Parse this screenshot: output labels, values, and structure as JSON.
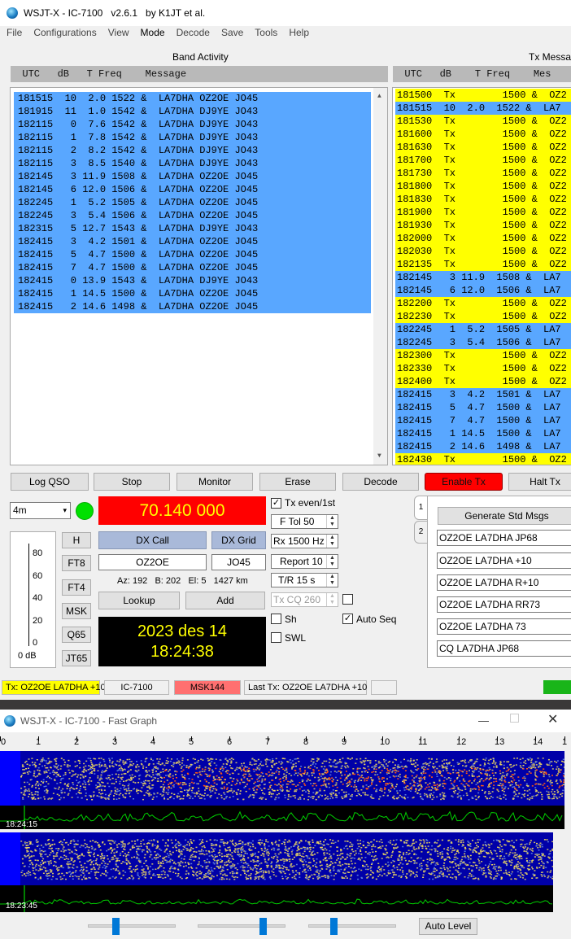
{
  "main_window": {
    "title": "WSJT-X - IC-7100   v2.6.1   by K1JT et al.",
    "menu": [
      "File",
      "Configurations",
      "View",
      "Mode",
      "Decode",
      "Save",
      "Tools",
      "Help"
    ],
    "band_activity_label": "Band Activity",
    "tx_messages_label": "Tx Messag",
    "columns_header": "  UTC   dB   T Freq    Message",
    "rx_columns_header": "  UTC   dB    T Freq    Mes",
    "band_activity_rows": [
      "181515  10  2.0 1522 &  LA7DHA OZ2OE JO45",
      "181915  11  1.0 1542 &  LA7DHA DJ9YE JO43",
      "182115   0  7.6 1542 &  LA7DHA DJ9YE JO43",
      "182115   1  7.8 1542 &  LA7DHA DJ9YE JO43",
      "182115   2  8.2 1542 &  LA7DHA DJ9YE JO43",
      "182115   3  8.5 1540 &  LA7DHA DJ9YE JO43",
      "182145   3 11.9 1508 &  LA7DHA OZ2OE JO45",
      "182145   6 12.0 1506 &  LA7DHA OZ2OE JO45",
      "182245   1  5.2 1505 &  LA7DHA OZ2OE JO45",
      "182245   3  5.4 1506 &  LA7DHA OZ2OE JO45",
      "182315   5 12.7 1543 &  LA7DHA DJ9YE JO43",
      "182415   3  4.2 1501 &  LA7DHA OZ2OE JO45",
      "182415   5  4.7 1500 &  LA7DHA OZ2OE JO45",
      "182415   7  4.7 1500 &  LA7DHA OZ2OE JO45",
      "182415   0 13.9 1543 &  LA7DHA DJ9YE JO43",
      "182415   1 14.5 1500 &  LA7DHA OZ2OE JO45",
      "182415   2 14.6 1498 &  LA7DHA OZ2OE JO45"
    ],
    "rx_rows": [
      {
        "text": "181500  Tx        1500 &  OZ2",
        "color": "yellow"
      },
      {
        "text": "181515  10  2.0  1522 &  LA7",
        "color": "blue"
      },
      {
        "text": "181530  Tx        1500 &  OZ2",
        "color": "yellow"
      },
      {
        "text": "181600  Tx        1500 &  OZ2",
        "color": "yellow"
      },
      {
        "text": "181630  Tx        1500 &  OZ2",
        "color": "yellow"
      },
      {
        "text": "181700  Tx        1500 &  OZ2",
        "color": "yellow"
      },
      {
        "text": "181730  Tx        1500 &  OZ2",
        "color": "yellow"
      },
      {
        "text": "181800  Tx        1500 &  OZ2",
        "color": "yellow"
      },
      {
        "text": "181830  Tx        1500 &  OZ2",
        "color": "yellow"
      },
      {
        "text": "181900  Tx        1500 &  OZ2",
        "color": "yellow"
      },
      {
        "text": "181930  Tx        1500 &  OZ2",
        "color": "yellow"
      },
      {
        "text": "182000  Tx        1500 &  OZ2",
        "color": "yellow"
      },
      {
        "text": "182030  Tx        1500 &  OZ2",
        "color": "yellow"
      },
      {
        "text": "182135  Tx        1500 &  OZ2",
        "color": "yellow"
      },
      {
        "text": "182145   3 11.9  1508 &  LA7",
        "color": "blue"
      },
      {
        "text": "182145   6 12.0  1506 &  LA7",
        "color": "blue"
      },
      {
        "text": "182200  Tx        1500 &  OZ2",
        "color": "yellow"
      },
      {
        "text": "182230  Tx        1500 &  OZ2",
        "color": "yellow"
      },
      {
        "text": "182245   1  5.2  1505 &  LA7",
        "color": "blue"
      },
      {
        "text": "182245   3  5.4  1506 &  LA7",
        "color": "blue"
      },
      {
        "text": "182300  Tx        1500 &  OZ2",
        "color": "yellow"
      },
      {
        "text": "182330  Tx        1500 &  OZ2",
        "color": "yellow"
      },
      {
        "text": "182400  Tx        1500 &  OZ2",
        "color": "yellow"
      },
      {
        "text": "182415   3  4.2  1501 &  LA7",
        "color": "blue"
      },
      {
        "text": "182415   5  4.7  1500 &  LA7",
        "color": "blue"
      },
      {
        "text": "182415   7  4.7  1500 &  LA7",
        "color": "blue"
      },
      {
        "text": "182415   1 14.5  1500 &  LA7",
        "color": "blue"
      },
      {
        "text": "182415   2 14.6  1498 &  LA7",
        "color": "blue"
      },
      {
        "text": "182430  Tx        1500 &  OZ2",
        "color": "yellow"
      }
    ],
    "buttons": {
      "log_qso": "Log QSO",
      "stop": "Stop",
      "monitor": "Monitor",
      "erase": "Erase",
      "decode": "Decode",
      "enable_tx": "Enable Tx",
      "halt_tx": "Halt Tx",
      "dx_call": "DX Call",
      "dx_grid": "DX Grid",
      "lookup": "Lookup",
      "add": "Add",
      "generate_std_msgs": "Generate Std Msgs",
      "mode_h": "H",
      "mode_ft8": "FT8",
      "mode_ft4": "FT4",
      "mode_msk": "MSK",
      "mode_q65": "Q65",
      "mode_jt65": "JT65"
    },
    "band": "4m",
    "frequency": "70.140 000",
    "dx_call_value": "OZ2OE",
    "dx_grid_value": "JO45",
    "az_info": "Az: 192   B: 202   El: 5   1427 km",
    "date": "2023 des 14",
    "time": "18:24:38",
    "level_scale": [
      "80",
      "60",
      "40",
      "20",
      "0"
    ],
    "level_value": "0 dB",
    "tx_even_label": "Tx even/1st",
    "f_tol": "F Tol  50",
    "rx_freq": "Rx  1500  Hz",
    "report": "Report 10",
    "tr_period": "T/R  15  s",
    "tx_cq": "Tx CQ  260",
    "sh_label": "Sh",
    "auto_seq_label": "Auto Seq",
    "swl_label": "SWL",
    "tab1": "1",
    "tab2": "2",
    "tx_messages": [
      "OZ2OE LA7DHA JP68",
      "OZ2OE LA7DHA +10",
      "OZ2OE LA7DHA R+10",
      "OZ2OE LA7DHA RR73",
      " OZ2OE LA7DHA 73",
      "CQ LA7DHA JP68"
    ],
    "status": {
      "tx_text": "Tx: OZ2OE LA7DHA +10",
      "radio": "IC-7100",
      "mode": "MSK144",
      "last_tx": "Last Tx: OZ2OE LA7DHA +10"
    },
    "colors": {
      "blue_row": "#59a7ff",
      "yellow_row": "#ffff00",
      "freq_bg": "#ff0000",
      "freq_fg": "#ffff00",
      "clock_bg": "#000000",
      "clock_fg": "#ffff00"
    }
  },
  "fast_graph": {
    "title": "WSJT-X - IC-7100 - Fast Graph",
    "scale": [
      "0",
      "1",
      "2",
      "3",
      "4",
      "5",
      "6",
      "7",
      "8",
      "9",
      "10",
      "11",
      "12",
      "13",
      "14",
      "1"
    ],
    "timestamp_top": "18:24:15",
    "timestamp_bottom": "18:23:45",
    "auto_level": "Auto Level",
    "minimize_icon": "minimize-icon",
    "maximize_icon": "maximize-icon",
    "close_icon": "close-icon"
  }
}
